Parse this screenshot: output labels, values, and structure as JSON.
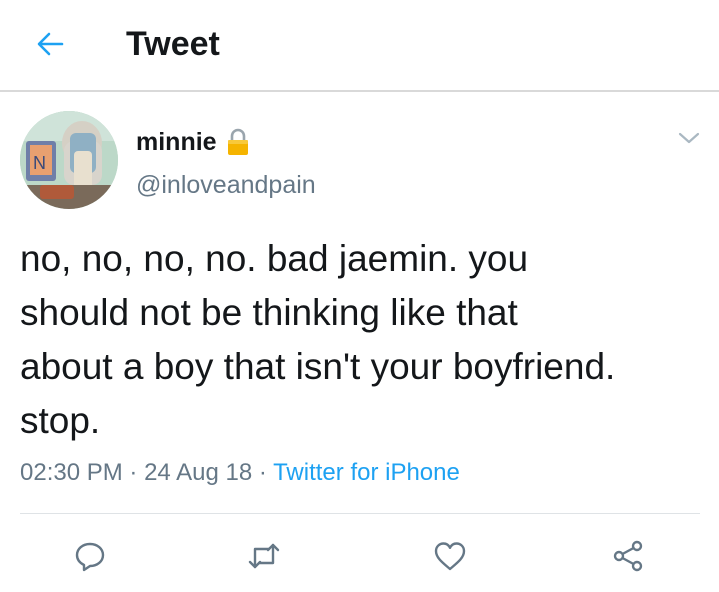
{
  "header": {
    "title": "Tweet",
    "back_icon": "arrow-left-icon"
  },
  "colors": {
    "accent": "#1da1f2",
    "text": "#14171a",
    "secondary_text": "#657786",
    "lock": "#f5b400"
  },
  "tweet": {
    "display_name": "minnie",
    "protected_icon": "lock-icon",
    "handle": "@inloveandpain",
    "text": "no, no, no, no. bad jaemin. you\nshould not be thinking like that\nabout a boy that isn't your boyfriend.\nstop.",
    "time": "02:30 PM",
    "separator": "·",
    "date": "24 Aug 18",
    "source": "Twitter for iPhone"
  },
  "actions": {
    "reply_icon": "reply-icon",
    "retweet_icon": "retweet-icon",
    "like_icon": "heart-icon",
    "share_icon": "share-icon"
  }
}
